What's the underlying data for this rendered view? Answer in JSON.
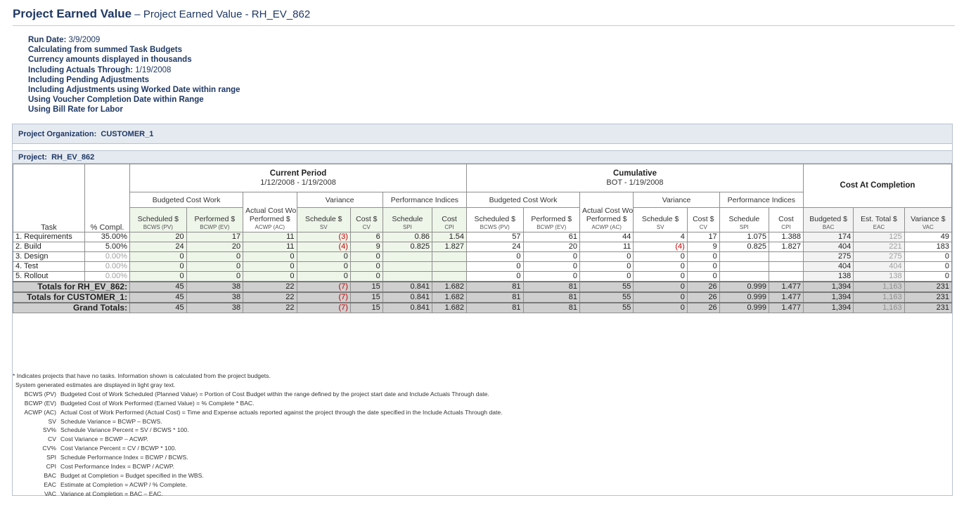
{
  "header": {
    "title": "Project Earned Value",
    "subtitle": " – Project Earned Value - RH_EV_862"
  },
  "params": {
    "run_date_label": "Run Date:",
    "run_date": "3/9/2009",
    "lines": [
      "Calculating from summed Task Budgets",
      "Currency amounts displayed in thousands"
    ],
    "actuals_label": "Including Actuals Through:",
    "actuals_date": "1/19/2008",
    "lines2": [
      "Including Pending Adjustments",
      "Including Adjustments using Worked Date within range",
      "Using Voucher Completion Date within Range",
      "Using Bill Rate for Labor"
    ]
  },
  "org": {
    "label": "Project Organization:",
    "value": "CUSTOMER_1"
  },
  "project": {
    "label": "Project:",
    "value": "RH_EV_862"
  },
  "groups": {
    "current": {
      "title": "Current Period",
      "range": "1/12/2008 - 1/19/2008"
    },
    "cumulative": {
      "title": "Cumulative",
      "range": "BOT - 1/19/2008"
    },
    "cac": {
      "title": "Cost At Completion"
    }
  },
  "subgroups": {
    "bcw": "Budgeted Cost Work",
    "acw": "Actual Cost Work",
    "var": "Variance",
    "pi": "Performance Indices"
  },
  "cols": {
    "task": "Task",
    "pct": "% Compl.",
    "sched": "Scheduled $",
    "sched_sub": "BCWS (PV)",
    "perf": "Performed $",
    "perf_sub": "BCWP (EV)",
    "acwp": "Performed $",
    "acwp_sub": "ACWP (AC)",
    "sv": "Schedule $",
    "sv_sub": "SV",
    "cv": "Cost $",
    "cv_sub": "CV",
    "spi": "Schedule",
    "spi_sub": "SPI",
    "cpi": "Cost",
    "cpi_sub": "CPI",
    "bac": "Budgeted $",
    "bac_sub": "BAC",
    "eac": "Est. Total $",
    "eac_sub": "EAC",
    "vac": "Variance $",
    "vac_sub": "VAC"
  },
  "rows": [
    {
      "task": "1. Requirements",
      "pct": "35.00%",
      "c_bcws": "20",
      "c_bcwp": "17",
      "c_acwp": "11",
      "c_sv": "(3)",
      "c_cv": "6",
      "c_spi": "0.86",
      "c_cpi": "1.54",
      "u_bcws": "57",
      "u_bcwp": "61",
      "u_acwp": "44",
      "u_sv": "4",
      "u_cv": "17",
      "u_spi": "1.075",
      "u_cpi": "1.388",
      "bac": "174",
      "eac": "125",
      "vac": "49"
    },
    {
      "task": "2. Build",
      "pct": "5.00%",
      "c_bcws": "24",
      "c_bcwp": "20",
      "c_acwp": "11",
      "c_sv": "(4)",
      "c_cv": "9",
      "c_spi": "0.825",
      "c_cpi": "1.827",
      "u_bcws": "24",
      "u_bcwp": "20",
      "u_acwp": "11",
      "u_sv": "(4)",
      "u_cv": "9",
      "u_spi": "0.825",
      "u_cpi": "1.827",
      "bac": "404",
      "eac": "221",
      "vac": "183"
    },
    {
      "task": "3. Design",
      "pct": "0.00%",
      "c_bcws": "0",
      "c_bcwp": "0",
      "c_acwp": "0",
      "c_sv": "0",
      "c_cv": "0",
      "c_spi": "",
      "c_cpi": "",
      "u_bcws": "0",
      "u_bcwp": "0",
      "u_acwp": "0",
      "u_sv": "0",
      "u_cv": "0",
      "u_spi": "",
      "u_cpi": "",
      "bac": "275",
      "eac": "275",
      "vac": "0"
    },
    {
      "task": "4. Test",
      "pct": "0.00%",
      "c_bcws": "0",
      "c_bcwp": "0",
      "c_acwp": "0",
      "c_sv": "0",
      "c_cv": "0",
      "c_spi": "",
      "c_cpi": "",
      "u_bcws": "0",
      "u_bcwp": "0",
      "u_acwp": "0",
      "u_sv": "0",
      "u_cv": "0",
      "u_spi": "",
      "u_cpi": "",
      "bac": "404",
      "eac": "404",
      "vac": "0"
    },
    {
      "task": "5. Rollout",
      "pct": "0.00%",
      "c_bcws": "0",
      "c_bcwp": "0",
      "c_acwp": "0",
      "c_sv": "0",
      "c_cv": "0",
      "c_spi": "",
      "c_cpi": "",
      "u_bcws": "0",
      "u_bcwp": "0",
      "u_acwp": "0",
      "u_sv": "0",
      "u_cv": "0",
      "u_spi": "",
      "u_cpi": "",
      "bac": "138",
      "eac": "138",
      "vac": "0"
    }
  ],
  "totals": [
    {
      "label": "Totals for RH_EV_862:",
      "c_bcws": "45",
      "c_bcwp": "38",
      "c_acwp": "22",
      "c_sv": "(7)",
      "c_cv": "15",
      "c_spi": "0.841",
      "c_cpi": "1.682",
      "u_bcws": "81",
      "u_bcwp": "81",
      "u_acwp": "55",
      "u_sv": "0",
      "u_cv": "26",
      "u_spi": "0.999",
      "u_cpi": "1.477",
      "bac": "1,394",
      "eac": "1,163",
      "vac": "231"
    },
    {
      "label": "Totals for CUSTOMER_1:",
      "c_bcws": "45",
      "c_bcwp": "38",
      "c_acwp": "22",
      "c_sv": "(7)",
      "c_cv": "15",
      "c_spi": "0.841",
      "c_cpi": "1.682",
      "u_bcws": "81",
      "u_bcwp": "81",
      "u_acwp": "55",
      "u_sv": "0",
      "u_cv": "26",
      "u_spi": "0.999",
      "u_cpi": "1.477",
      "bac": "1,394",
      "eac": "1,163",
      "vac": "231"
    },
    {
      "label": "Grand Totals:",
      "c_bcws": "45",
      "c_bcwp": "38",
      "c_acwp": "22",
      "c_sv": "(7)",
      "c_cv": "15",
      "c_spi": "0.841",
      "c_cpi": "1.682",
      "u_bcws": "81",
      "u_bcwp": "81",
      "u_acwp": "55",
      "u_sv": "0",
      "u_cv": "26",
      "u_spi": "0.999",
      "u_cpi": "1.477",
      "bac": "1,394",
      "eac": "1,163",
      "vac": "231"
    }
  ],
  "notes": {
    "line1": "* Indicates projects that have no tasks. Information shown is calculated from the project budgets.",
    "line2": "System generated estimates are displayed in light gray text.",
    "defs": [
      {
        "abbr": "BCWS (PV)",
        "text": "Budgeted Cost of Work Scheduled (Planned Value) = Portion of Cost Budget within the range defined by the project start date and Include Actuals Through date."
      },
      {
        "abbr": "BCWP (EV)",
        "text": "Budgeted Cost of Work Performed (Earned Value) = % Complete * BAC."
      },
      {
        "abbr": "ACWP (AC)",
        "text": "Actual Cost of Work Performed (Actual Cost) = Time and Expense actuals reported against the project through the date specified in the Include Actuals Through date."
      },
      {
        "abbr": "SV",
        "text": "Schedule Variance = BCWP – BCWS."
      },
      {
        "abbr": "SV%",
        "text": "Schedule Variance Percent = SV / BCWS * 100."
      },
      {
        "abbr": "CV",
        "text": "Cost Variance = BCWP – ACWP."
      },
      {
        "abbr": "CV%",
        "text": "Cost Variance Percent = CV / BCWP * 100."
      },
      {
        "abbr": "SPI",
        "text": "Schedule Performance Index = BCWP / BCWS."
      },
      {
        "abbr": "CPI",
        "text": "Cost Performance Index = BCWP / ACWP."
      },
      {
        "abbr": "BAC",
        "text": "Budget at Completion = Budget specified in the WBS."
      },
      {
        "abbr": "EAC",
        "text": "Estimate at Completion = ACWP / % Complete."
      },
      {
        "abbr": "VAC",
        "text": "Variance at Completion = BAC – EAC."
      }
    ]
  }
}
